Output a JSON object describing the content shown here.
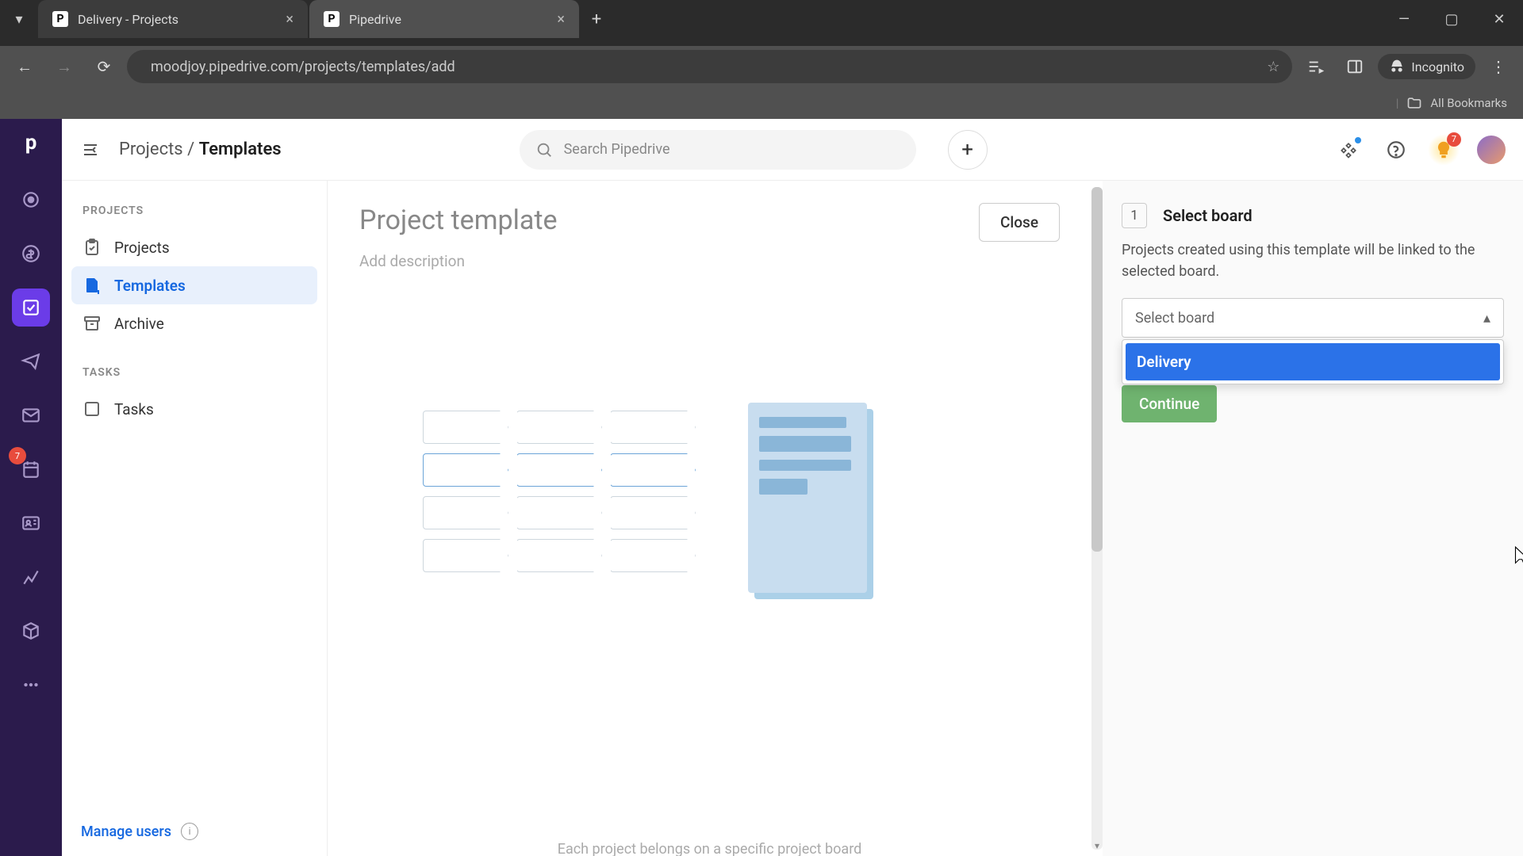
{
  "browser": {
    "tabs": [
      {
        "title": "Delivery - Projects",
        "active": false
      },
      {
        "title": "Pipedrive",
        "active": true
      }
    ],
    "url": "moodjoy.pipedrive.com/projects/templates/add",
    "incognito_label": "Incognito",
    "all_bookmarks": "All Bookmarks"
  },
  "header": {
    "breadcrumb_root": "Projects",
    "breadcrumb_current": "Templates",
    "search_placeholder": "Search Pipedrive",
    "notification_count": "7"
  },
  "sidebar": {
    "group_projects": "PROJECTS",
    "projects": "Projects",
    "templates": "Templates",
    "archive": "Archive",
    "group_tasks": "TASKS",
    "tasks": "Tasks",
    "manage_users": "Manage users"
  },
  "content": {
    "title": "Project template",
    "desc_placeholder": "Add description",
    "close": "Close",
    "hint": "Each project belongs on a specific project board"
  },
  "panel": {
    "step_num": "1",
    "step_title": "Select board",
    "step_desc": "Projects created using this template will be linked to the selected board.",
    "select_placeholder": "Select board",
    "dropdown_option": "Delivery",
    "continue": "Continue"
  },
  "rail_badge": "7"
}
